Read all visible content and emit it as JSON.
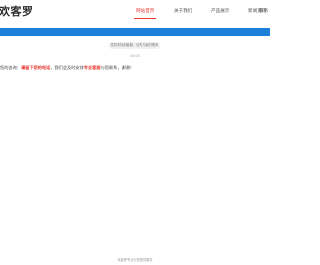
{
  "header": {
    "logo_text": "欢客罗",
    "nav": [
      {
        "label": "网站首页",
        "active": true
      },
      {
        "label": "关于我们",
        "active": false
      },
      {
        "label": "产品展示",
        "active": false
      },
      {
        "label": "新闻资讯",
        "active": false
      },
      {
        "label": "服务",
        "active": false
      }
    ]
  },
  "chat": {
    "notice": "您暂未找到客服，请先与我们联系",
    "time": "00:00",
    "message_prefix": "您的咨询：",
    "message_highlight1": "请留下您的电话",
    "message_mid": "，我们会及时安排",
    "message_highlight2": "专业客服",
    "message_suffix": "与您联系，谢谢！"
  },
  "footer": {
    "text": "欢客罗专业为您提供服务"
  },
  "colors": {
    "accent": "#e8382f",
    "bar": "#1e7fd8"
  }
}
